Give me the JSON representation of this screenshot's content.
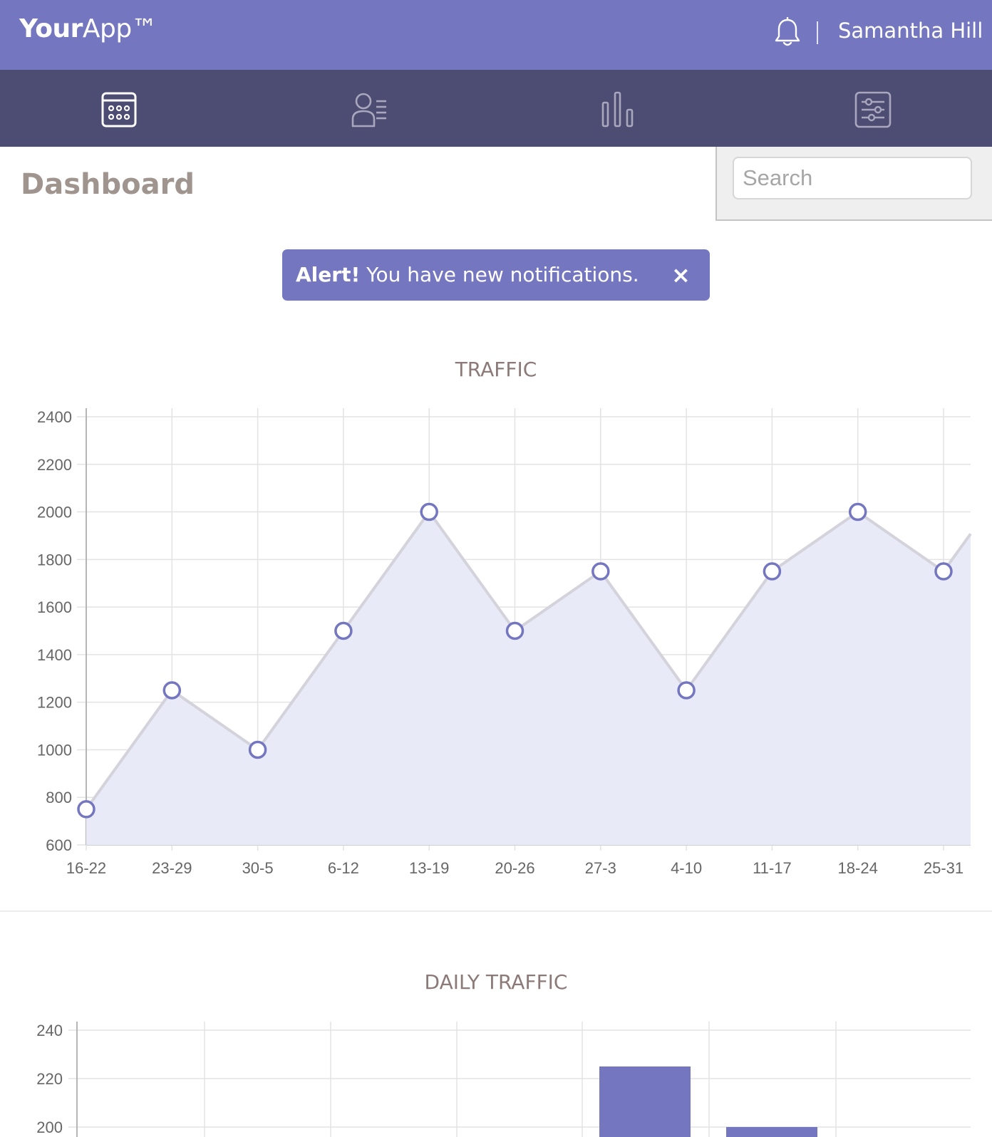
{
  "header": {
    "logo_bold": "Your",
    "logo_light": "App™",
    "user_name": "Samantha Hill"
  },
  "nav": {
    "items": [
      {
        "icon": "calendar-icon"
      },
      {
        "icon": "members-icon"
      },
      {
        "icon": "bar-chart-icon"
      },
      {
        "icon": "settings-sliders-icon"
      }
    ]
  },
  "page": {
    "title": "Dashboard"
  },
  "search": {
    "placeholder": "Search"
  },
  "alert": {
    "strong": "Alert!",
    "message": " You have new notifications.",
    "close_label": "×"
  },
  "colors": {
    "accent": "#7476c0",
    "nav_bg": "#4d4c72",
    "area_fill": "#e9eaf7",
    "title_gray": "#a0948f"
  },
  "chart_data": [
    {
      "type": "area",
      "title": "TRAFFIC",
      "categories": [
        "16-22",
        "23-29",
        "30-5",
        "6-12",
        "13-19",
        "20-26",
        "27-3",
        "4-10",
        "11-17",
        "18-24",
        "25-31"
      ],
      "values": [
        750,
        1250,
        1000,
        1500,
        2000,
        1500,
        1750,
        1250,
        1750,
        2000,
        1750
      ],
      "trailing_value": 2250,
      "ylim": [
        600,
        2400
      ],
      "yticks": [
        600,
        800,
        1000,
        1200,
        1400,
        1600,
        1800,
        2000,
        2200,
        2400
      ],
      "grid": true,
      "legend": "none"
    },
    {
      "type": "bar",
      "title": "DAILY TRAFFIC",
      "visible_bar_values": [
        225,
        200
      ],
      "ylim_visible": [
        190,
        240
      ],
      "yticks": [
        200,
        220,
        240
      ],
      "grid": true,
      "legend": "none"
    }
  ]
}
